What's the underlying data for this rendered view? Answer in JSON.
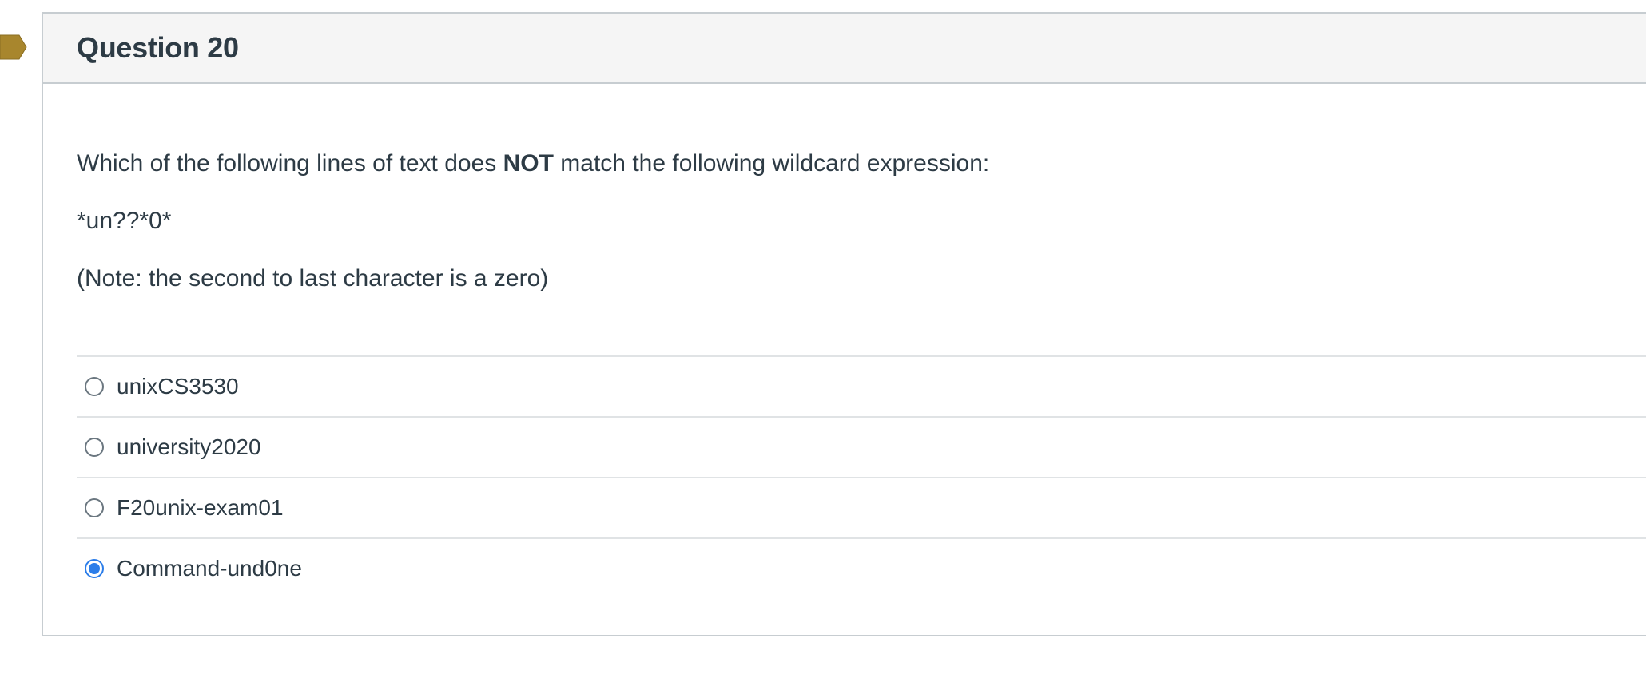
{
  "question": {
    "title": "Question 20",
    "prompt_before": "Which of the following lines of text does ",
    "prompt_emphasis": "NOT",
    "prompt_after": " match the following wildcard expression:",
    "expression": "*un??*0*",
    "note": "(Note: the second to last character is a zero)"
  },
  "answers": [
    {
      "label": "unixCS3530",
      "selected": false
    },
    {
      "label": "university2020",
      "selected": false
    },
    {
      "label": "F20unix-exam01",
      "selected": false
    },
    {
      "label": "Command-und0ne",
      "selected": true
    }
  ],
  "colors": {
    "flag": "#a8862d",
    "selected_radio": "#2b7de9",
    "header_bg": "#f5f5f5"
  }
}
